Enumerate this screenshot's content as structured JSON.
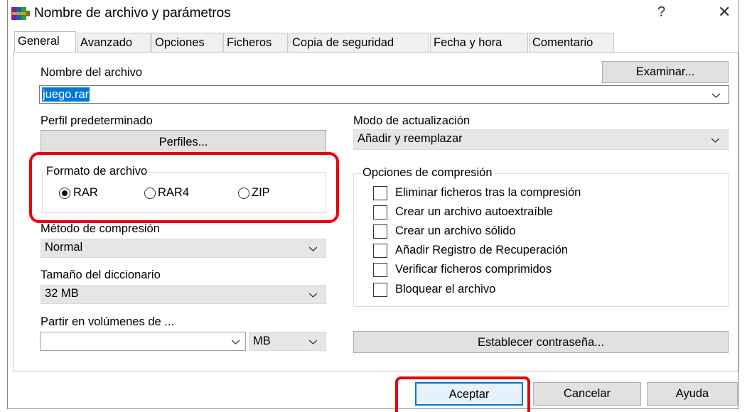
{
  "window": {
    "title": "Nombre de archivo y parámetros",
    "help_glyph": "?",
    "close_glyph": "✕"
  },
  "tabs": [
    {
      "label": "General",
      "active": true
    },
    {
      "label": "Avanzado"
    },
    {
      "label": "Opciones"
    },
    {
      "label": "Ficheros"
    },
    {
      "label": "Copia de seguridad"
    },
    {
      "label": "Fecha y hora"
    },
    {
      "label": "Comentario"
    }
  ],
  "general": {
    "archive_name_label": "Nombre del archivo",
    "browse_button": "Examinar...",
    "archive_name_value": "juego.rar",
    "default_profile_label": "Perfil predeterminado",
    "profiles_button": "Perfiles...",
    "update_mode_label": "Modo de actualización",
    "update_mode_value": "Añadir y reemplazar",
    "archive_format": {
      "title": "Formato de archivo",
      "options": [
        "RAR",
        "RAR4",
        "ZIP"
      ],
      "selected": "RAR"
    },
    "compression_options": {
      "title": "Opciones de compresión",
      "items": [
        {
          "label": "Eliminar ficheros tras la compresión",
          "checked": false
        },
        {
          "label": "Crear un archivo autoextraíble",
          "checked": false
        },
        {
          "label": "Crear un archivo sólido",
          "checked": false
        },
        {
          "label": "Añadir Registro de Recuperación",
          "checked": false
        },
        {
          "label": "Verificar ficheros comprimidos",
          "checked": false
        },
        {
          "label": "Bloquear el archivo",
          "checked": false
        }
      ]
    },
    "compression_method_label": "Método de compresión",
    "compression_method_value": "Normal",
    "dictionary_size_label": "Tamaño del diccionario",
    "dictionary_size_value": "32 MB",
    "split_volumes_label": "Partir en volúmenes de ...",
    "split_volumes_value": "",
    "split_unit_value": "MB",
    "set_password_button": "Establecer contraseña..."
  },
  "footer": {
    "ok_button": "Aceptar",
    "cancel_button": "Cancelar",
    "help_button": "Ayuda"
  },
  "colors": {
    "highlight_red": "#e8000b",
    "selection_blue": "#0078d7"
  }
}
